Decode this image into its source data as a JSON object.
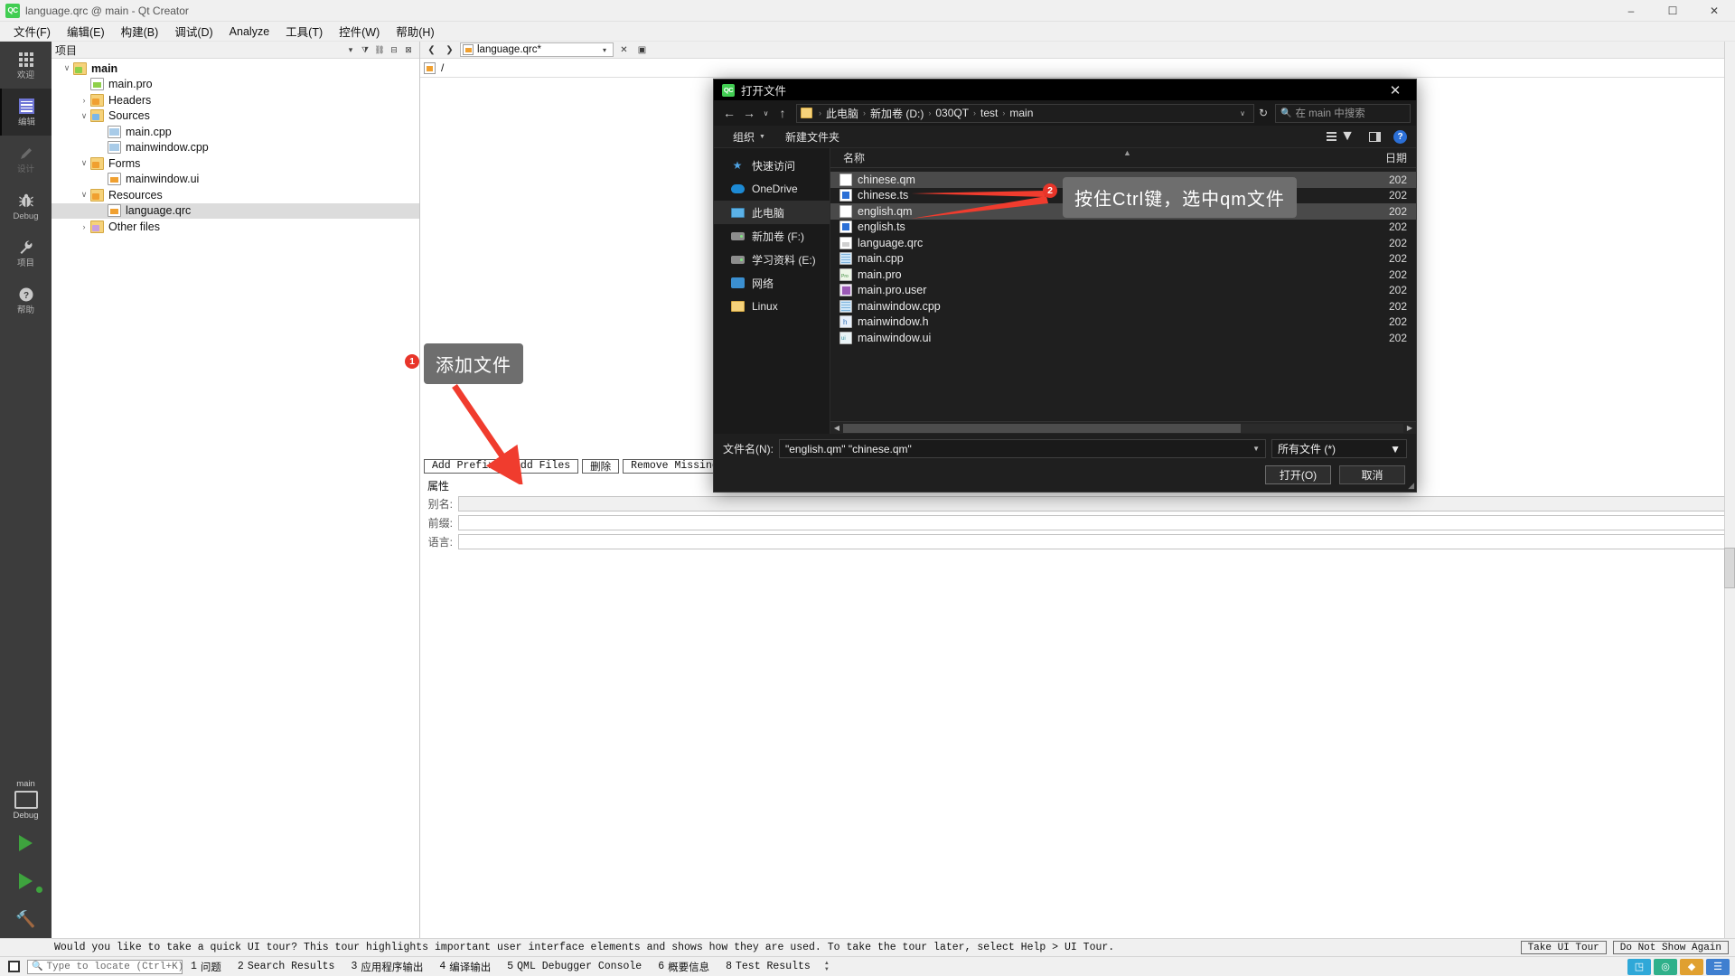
{
  "window": {
    "title": "language.qrc @ main - Qt Creator",
    "app_icon": "QC",
    "minimize": "–",
    "maximize": "☐",
    "close": "✕"
  },
  "menubar": [
    {
      "label": "文件(F)"
    },
    {
      "label": "编辑(E)"
    },
    {
      "label": "构建(B)"
    },
    {
      "label": "调试(D)"
    },
    {
      "label": "Analyze"
    },
    {
      "label": "工具(T)"
    },
    {
      "label": "控件(W)"
    },
    {
      "label": "帮助(H)"
    }
  ],
  "modebar": {
    "items": [
      {
        "label": "欢迎",
        "icon": "grid-icon",
        "state": "normal"
      },
      {
        "label": "编辑",
        "icon": "edit-icon",
        "state": "active"
      },
      {
        "label": "设计",
        "icon": "pencil-icon",
        "state": "disabled"
      },
      {
        "label": "Debug",
        "icon": "bug-icon",
        "state": "normal"
      },
      {
        "label": "项目",
        "icon": "wrench-icon",
        "state": "normal"
      },
      {
        "label": "帮助",
        "icon": "question-icon",
        "state": "normal"
      }
    ],
    "kit_name": "main",
    "kit_config": "Debug"
  },
  "tree_panel": {
    "header": "项目",
    "nodes": [
      {
        "label": "main",
        "indent": 0,
        "twisty": "∨",
        "icon": "qt-project-folder-icon",
        "bold": true,
        "selected": false
      },
      {
        "label": "main.pro",
        "indent": 1,
        "twisty": "",
        "icon": "pro-file-icon",
        "bold": false,
        "selected": false
      },
      {
        "label": "Headers",
        "indent": 1,
        "twisty": "›",
        "icon": "headers-folder-icon",
        "bold": false,
        "selected": false
      },
      {
        "label": "Sources",
        "indent": 1,
        "twisty": "∨",
        "icon": "sources-folder-icon",
        "bold": false,
        "selected": false
      },
      {
        "label": "main.cpp",
        "indent": 2,
        "twisty": "",
        "icon": "cpp-file-icon",
        "bold": false,
        "selected": false
      },
      {
        "label": "mainwindow.cpp",
        "indent": 2,
        "twisty": "",
        "icon": "cpp-file-icon",
        "bold": false,
        "selected": false
      },
      {
        "label": "Forms",
        "indent": 1,
        "twisty": "∨",
        "icon": "forms-folder-icon",
        "bold": false,
        "selected": false
      },
      {
        "label": "mainwindow.ui",
        "indent": 2,
        "twisty": "",
        "icon": "ui-file-icon",
        "bold": false,
        "selected": false
      },
      {
        "label": "Resources",
        "indent": 1,
        "twisty": "∨",
        "icon": "resources-folder-icon",
        "bold": false,
        "selected": false
      },
      {
        "label": "language.qrc",
        "indent": 2,
        "twisty": "",
        "icon": "qrc-file-icon",
        "bold": false,
        "selected": true
      },
      {
        "label": "Other files",
        "indent": 1,
        "twisty": "›",
        "icon": "other-folder-icon",
        "bold": false,
        "selected": false
      }
    ]
  },
  "editor": {
    "open_document": "language.qrc*",
    "qrc_root_path": "/",
    "buttons": {
      "add_prefix": "Add Prefix",
      "add_files": "Add Files",
      "remove": "删除",
      "remove_missing": "Remove Missing Files"
    },
    "properties": {
      "heading": "属性",
      "alias_label": "别名:",
      "alias_value": "",
      "prefix_label": "前缀:",
      "prefix_value": "",
      "language_label": "语言:",
      "language_value": ""
    }
  },
  "annotations": [
    {
      "number": "1",
      "text": "添加文件"
    },
    {
      "number": "2",
      "text": "按住Ctrl键，选中qm文件"
    }
  ],
  "dialog": {
    "title": "打开文件",
    "icon": "QC",
    "close": "✕",
    "nav": {
      "back": "←",
      "forward": "→",
      "recent": "∨",
      "up": "↑",
      "refresh": "↻",
      "dropdown_caret": "∨"
    },
    "breadcrumb": [
      "此电脑",
      "新加卷 (D:)",
      "030QT",
      "test",
      "main"
    ],
    "search_placeholder": "在 main 中搜索",
    "toolbar": {
      "organize": "组织",
      "new_folder": "新建文件夹",
      "view_mode": "list-view-icon",
      "preview_pane": "preview-pane-icon",
      "help": "?"
    },
    "sidebar": [
      {
        "label": "快速访问",
        "icon": "pin-icon",
        "active": false
      },
      {
        "label": "OneDrive",
        "icon": "cloud-icon",
        "active": false
      },
      {
        "label": "此电脑",
        "icon": "computer-icon",
        "active": true
      },
      {
        "label": "新加卷 (F:)",
        "icon": "drive-icon",
        "active": false
      },
      {
        "label": "学习资料 (E:)",
        "icon": "drive-icon",
        "active": false
      },
      {
        "label": "网络",
        "icon": "network-icon",
        "active": false
      },
      {
        "label": "Linux",
        "icon": "folder-icon",
        "active": false
      }
    ],
    "columns": {
      "name": "名称",
      "date": "日期"
    },
    "files": [
      {
        "name": "chinese.qm",
        "icon": "generic-file-icon",
        "date": "202",
        "selected": true
      },
      {
        "name": "chinese.ts",
        "icon": "ts-file-icon",
        "date": "202",
        "selected": false
      },
      {
        "name": "english.qm",
        "icon": "generic-file-icon",
        "date": "202",
        "selected": true
      },
      {
        "name": "english.ts",
        "icon": "ts-file-icon",
        "date": "202",
        "selected": false
      },
      {
        "name": "language.qrc",
        "icon": "qrc-file-icon",
        "date": "202",
        "selected": false
      },
      {
        "name": "main.cpp",
        "icon": "cpp-file-icon",
        "date": "202",
        "selected": false
      },
      {
        "name": "main.pro",
        "icon": "pro-file-icon",
        "date": "202",
        "selected": false
      },
      {
        "name": "main.pro.user",
        "icon": "user-file-icon",
        "date": "202",
        "selected": false
      },
      {
        "name": "mainwindow.cpp",
        "icon": "cpp-file-icon",
        "date": "202",
        "selected": false
      },
      {
        "name": "mainwindow.h",
        "icon": "h-file-icon",
        "date": "202",
        "selected": false
      },
      {
        "name": "mainwindow.ui",
        "icon": "ui-file-icon",
        "date": "202",
        "selected": false
      }
    ],
    "filename_label": "文件名(N):",
    "filename_value": "\"english.qm\" \"chinese.qm\"",
    "filetype_value": "所有文件 (*)",
    "open_button": "打开(O)",
    "cancel_button": "取消"
  },
  "tour": {
    "message": "Would you like to take a quick UI tour? This tour highlights important user interface elements and shows how they are used. To take the tour later, select Help > UI Tour.",
    "take_tour": "Take UI Tour",
    "do_not_show": "Do Not Show Again"
  },
  "statusbar": {
    "locator_placeholder": "Type to locate (Ctrl+K)",
    "items": [
      {
        "num": "1",
        "label": "问题"
      },
      {
        "num": "2",
        "label": "Search Results"
      },
      {
        "num": "3",
        "label": "应用程序输出"
      },
      {
        "num": "4",
        "label": "编译输出"
      },
      {
        "num": "5",
        "label": "QML Debugger Console"
      },
      {
        "num": "6",
        "label": "概要信息"
      },
      {
        "num": "8",
        "label": "Test Results"
      }
    ]
  }
}
